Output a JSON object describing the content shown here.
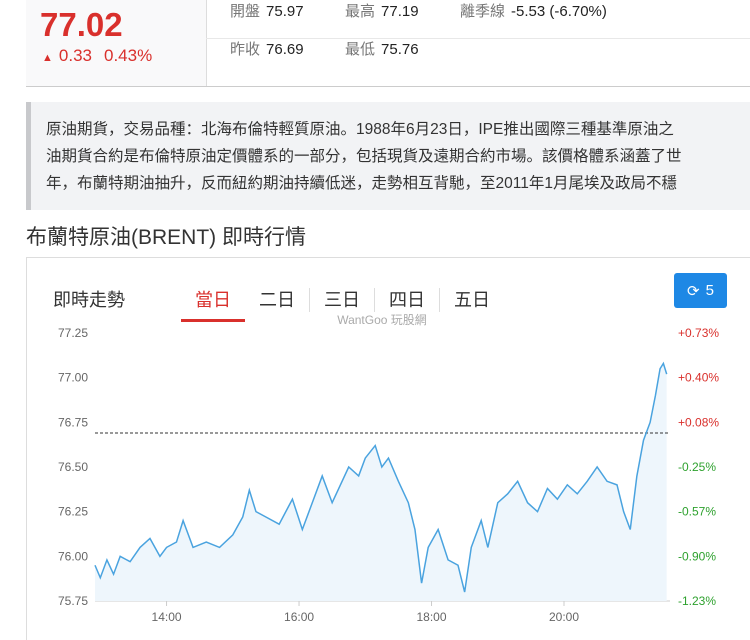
{
  "quote": {
    "price": "77.02",
    "change": "0.33",
    "change_pct": "0.43%",
    "up_icon": "triangle-up-icon",
    "stats": [
      {
        "label": "開盤",
        "value": "75.97"
      },
      {
        "label": "最高",
        "value": "77.19"
      },
      {
        "label": "離季線",
        "value": "-5.53 (-6.70%)"
      },
      {
        "label": "昨收",
        "value": "76.69"
      },
      {
        "label": "最低",
        "value": "75.76"
      }
    ]
  },
  "description": [
    "原油期貨，交易品種：北海布倫特輕質原油。1988年6月23日，IPE推出國際三種基準原油之",
    "油期貨合約是布倫特原油定價體系的一部分，包括現貨及遠期合約市場。該價格體系涵蓋了世",
    "年，布蘭特期油抽升，反而紐約期油持續低迷，走勢相互背馳，至2011年1月尾埃及政局不穩"
  ],
  "section_title": "布蘭特原油(BRENT) 即時行情",
  "chart_header": {
    "title": "即時走勢",
    "tabs": [
      "當日",
      "二日",
      "三日",
      "四日",
      "五日"
    ],
    "active_tab": 0,
    "refresh_label": "5"
  },
  "colors": {
    "up": "#d9302c",
    "down": "#2ea12e",
    "line": "#4aa3df",
    "fill": "#eef6fc",
    "accent": "#1e88e5"
  },
  "chart_data": {
    "type": "area",
    "watermark": "WantGoo 玩股網",
    "prev_close": 76.69,
    "ylim": [
      75.75,
      77.25
    ],
    "y_ticks": [
      "77.25",
      "77.00",
      "76.75",
      "76.50",
      "76.25",
      "76.00",
      "75.75"
    ],
    "pct_ticks": [
      "+0.73%",
      "+0.40%",
      "+0.08%",
      "-0.25%",
      "-0.57%",
      "-0.90%",
      "-1.23%"
    ],
    "x_ticks": [
      "14:00",
      "16:00",
      "18:00",
      "20:00"
    ],
    "x_tick_hours": [
      14,
      16,
      18,
      20
    ],
    "xlim": [
      12.92,
      21.6
    ],
    "series": [
      [
        12.92,
        75.95
      ],
      [
        13.0,
        75.88
      ],
      [
        13.1,
        75.98
      ],
      [
        13.2,
        75.9
      ],
      [
        13.3,
        76.0
      ],
      [
        13.45,
        75.97
      ],
      [
        13.6,
        76.05
      ],
      [
        13.75,
        76.1
      ],
      [
        13.9,
        76.0
      ],
      [
        14.0,
        76.05
      ],
      [
        14.15,
        76.08
      ],
      [
        14.25,
        76.2
      ],
      [
        14.4,
        76.05
      ],
      [
        14.6,
        76.08
      ],
      [
        14.8,
        76.05
      ],
      [
        15.0,
        76.12
      ],
      [
        15.15,
        76.22
      ],
      [
        15.25,
        76.37
      ],
      [
        15.35,
        76.25
      ],
      [
        15.5,
        76.22
      ],
      [
        15.7,
        76.18
      ],
      [
        15.9,
        76.32
      ],
      [
        16.05,
        76.15
      ],
      [
        16.2,
        76.3
      ],
      [
        16.35,
        76.45
      ],
      [
        16.5,
        76.3
      ],
      [
        16.6,
        76.38
      ],
      [
        16.75,
        76.5
      ],
      [
        16.9,
        76.45
      ],
      [
        17.0,
        76.55
      ],
      [
        17.15,
        76.62
      ],
      [
        17.25,
        76.5
      ],
      [
        17.35,
        76.55
      ],
      [
        17.5,
        76.42
      ],
      [
        17.65,
        76.3
      ],
      [
        17.75,
        76.15
      ],
      [
        17.85,
        75.85
      ],
      [
        17.95,
        76.05
      ],
      [
        18.1,
        76.15
      ],
      [
        18.25,
        75.98
      ],
      [
        18.4,
        75.95
      ],
      [
        18.5,
        75.8
      ],
      [
        18.6,
        76.05
      ],
      [
        18.75,
        76.2
      ],
      [
        18.85,
        76.05
      ],
      [
        19.0,
        76.3
      ],
      [
        19.15,
        76.35
      ],
      [
        19.3,
        76.42
      ],
      [
        19.45,
        76.3
      ],
      [
        19.6,
        76.25
      ],
      [
        19.75,
        76.38
      ],
      [
        19.9,
        76.32
      ],
      [
        20.05,
        76.4
      ],
      [
        20.2,
        76.35
      ],
      [
        20.35,
        76.42
      ],
      [
        20.5,
        76.5
      ],
      [
        20.65,
        76.42
      ],
      [
        20.8,
        76.4
      ],
      [
        20.9,
        76.25
      ],
      [
        21.0,
        76.15
      ],
      [
        21.1,
        76.45
      ],
      [
        21.2,
        76.65
      ],
      [
        21.3,
        76.75
      ],
      [
        21.38,
        76.9
      ],
      [
        21.45,
        77.05
      ],
      [
        21.5,
        77.08
      ],
      [
        21.55,
        77.02
      ]
    ]
  }
}
